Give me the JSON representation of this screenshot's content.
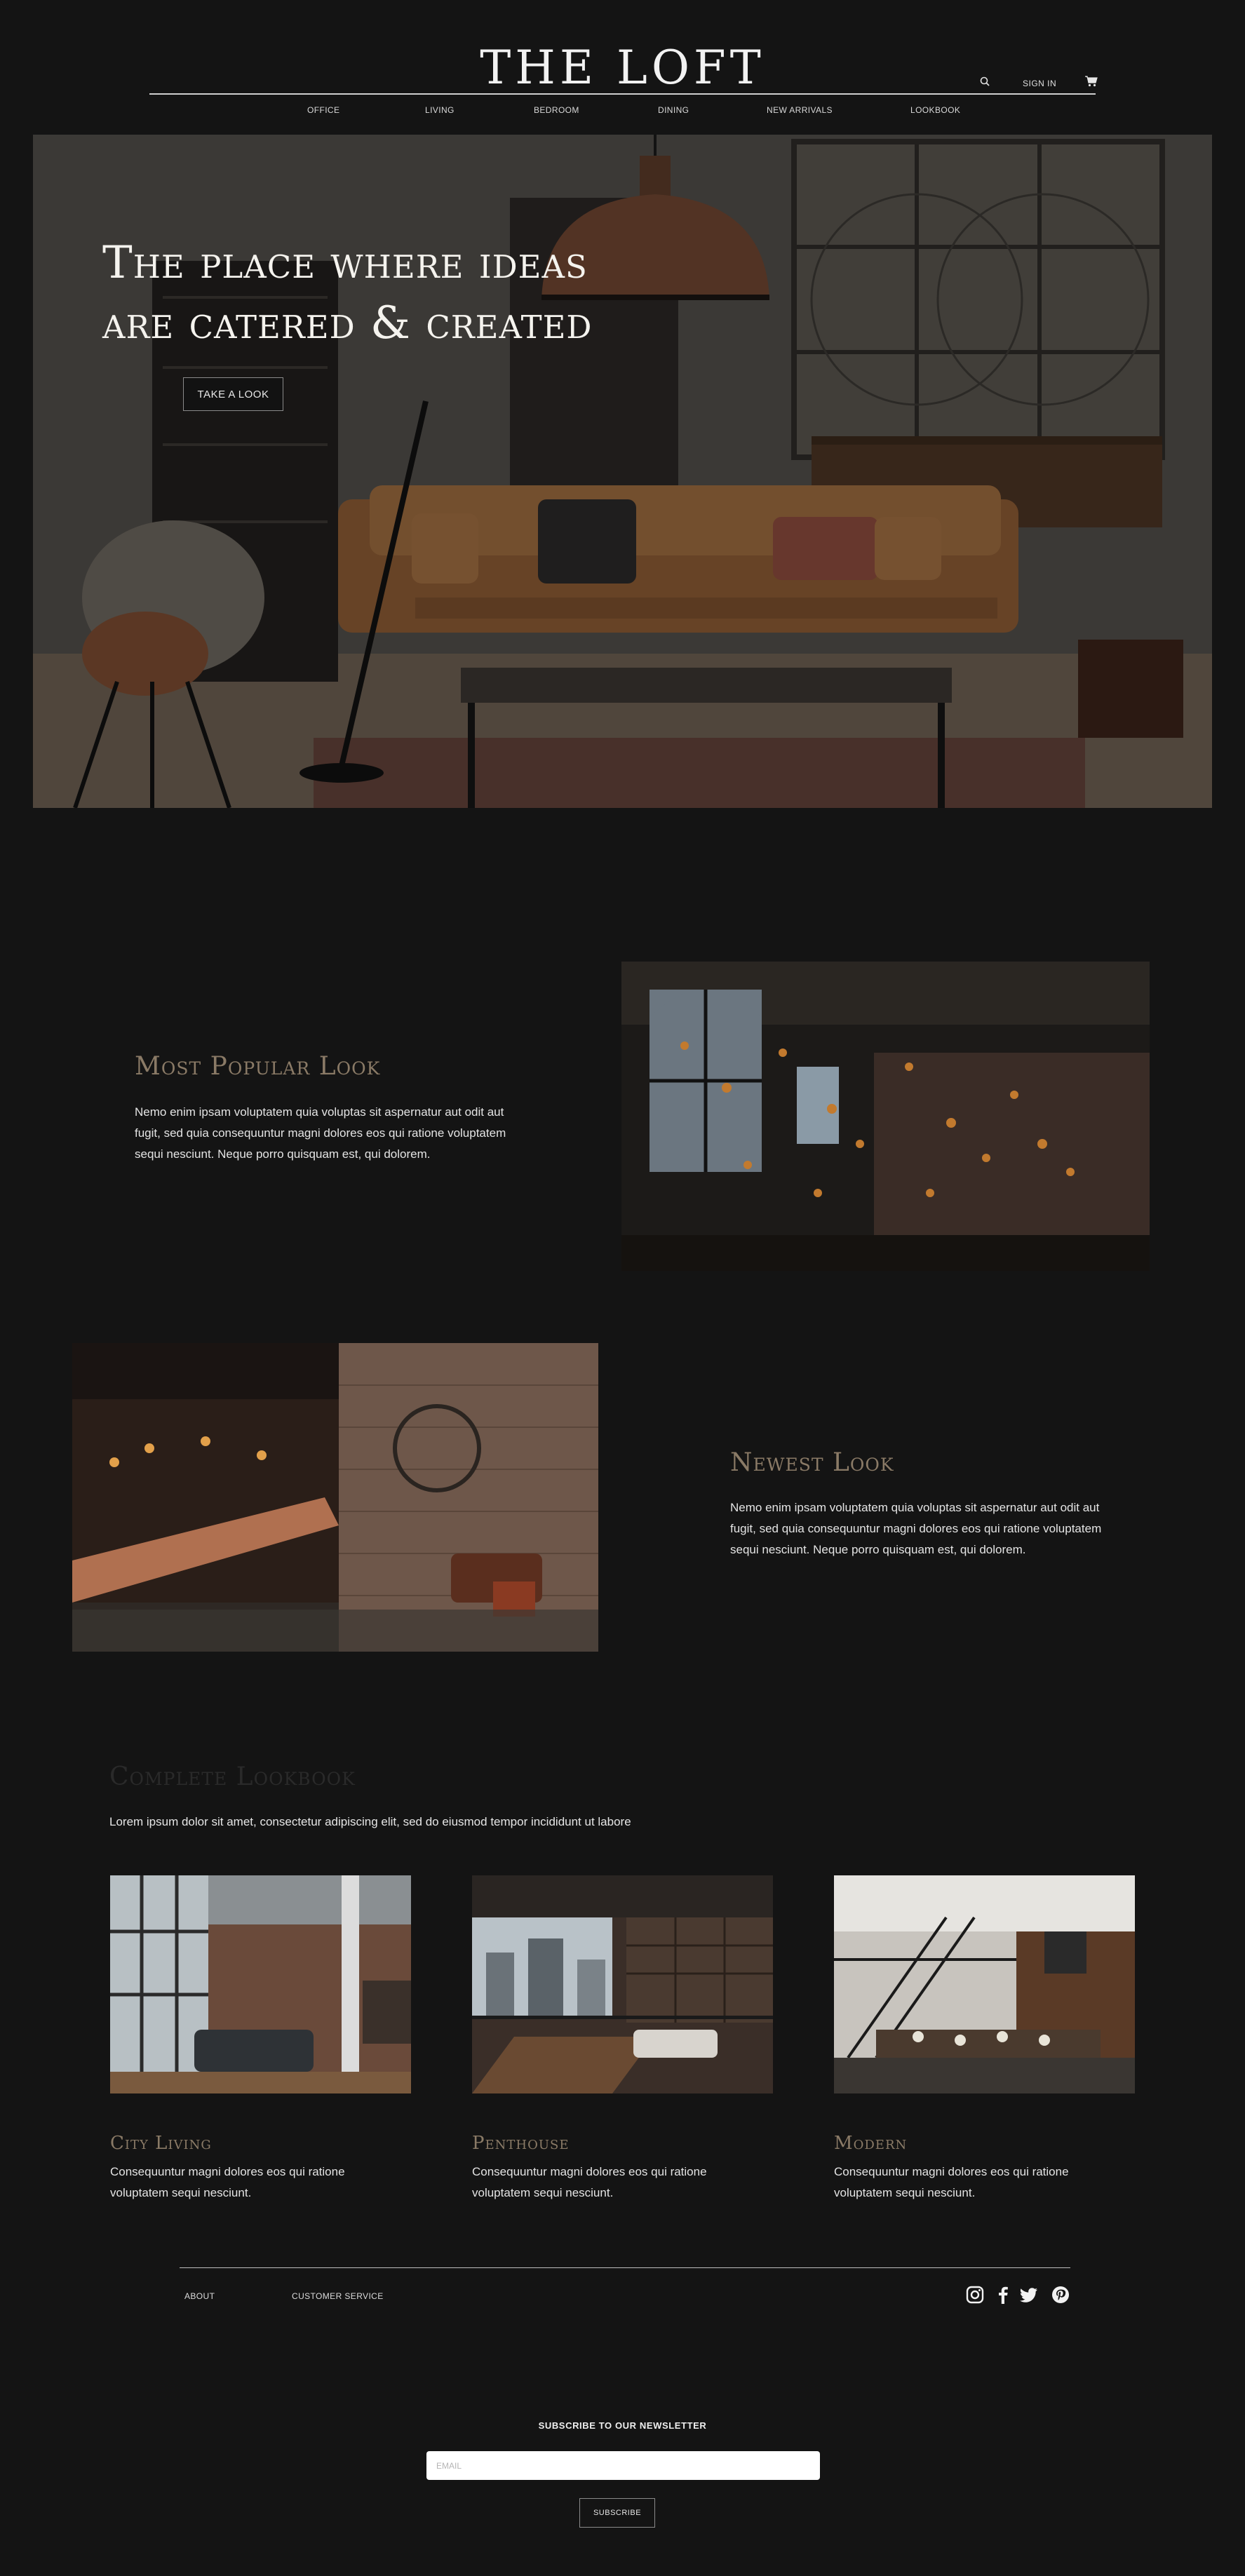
{
  "brand": {
    "logo": "THE LOFT"
  },
  "header": {
    "signin_label": "SIGN IN",
    "nav": [
      "OFFICE",
      "LIVING",
      "BEDROOM",
      "DINING",
      "NEW ARRIVALS",
      "LOOKBOOK"
    ]
  },
  "hero": {
    "title_line1": "The place where ideas",
    "title_line2": "are catered & created",
    "button_label": "TAKE A LOOK"
  },
  "popular": {
    "title": "Most Popular Look",
    "text": "Nemo enim ipsam voluptatem quia voluptas sit aspernatur aut odit aut fugit, sed quia consequuntur magni dolores eos qui ratione voluptatem sequi nesciunt. Neque porro quisquam est, qui dolorem."
  },
  "newest": {
    "title": "Newest Look",
    "text": "Nemo enim ipsam voluptatem quia voluptas sit aspernatur aut odit aut fugit, sed quia consequuntur magni dolores eos qui ratione voluptatem sequi nesciunt. Neque porro quisquam est, qui dolorem."
  },
  "lookbook": {
    "title": "Complete Lookbook",
    "subtitle": "Lorem ipsum dolor sit amet, consectetur adipiscing elit, sed do eiusmod tempor incididunt ut labore",
    "cards": [
      {
        "title": "City Living",
        "text": "Consequuntur magni dolores eos qui ratione voluptatem sequi nesciunt."
      },
      {
        "title": "Penthouse",
        "text": "Consequuntur magni dolores eos qui ratione voluptatem sequi nesciunt."
      },
      {
        "title": "Modern",
        "text": "Consequuntur magni dolores eos qui ratione voluptatem sequi nesciunt."
      }
    ]
  },
  "footer": {
    "links": [
      "ABOUT",
      "CUSTOMER SERVICE"
    ],
    "social_icons": [
      "instagram-icon",
      "facebook-icon",
      "twitter-icon",
      "pinterest-icon"
    ]
  },
  "newsletter": {
    "title": "SUBSCRIBE TO OUR NEWSLETTER",
    "email_placeholder": "EMAIL",
    "button_label": "SUBSCRIBE"
  }
}
